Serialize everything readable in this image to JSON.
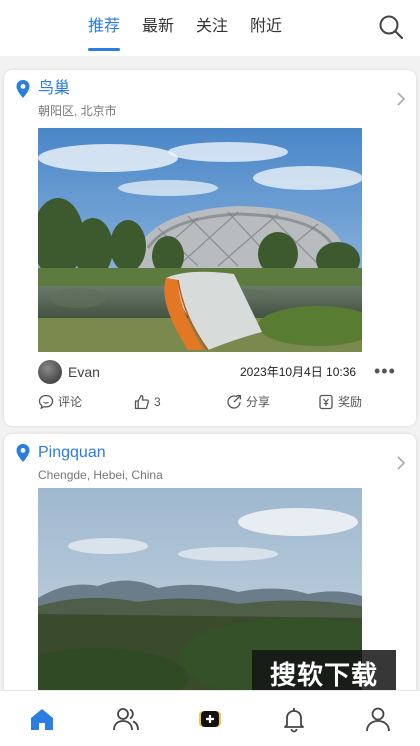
{
  "top_tabs": [
    {
      "label": "推荐"
    },
    {
      "label": "最新"
    },
    {
      "label": "关注"
    },
    {
      "label": "附近"
    }
  ],
  "posts": [
    {
      "place": "鸟巢",
      "location": "朝阳区, 北京市",
      "author": "Evan",
      "datetime": "2023年10月4日 10:36",
      "more": "•••",
      "actions": {
        "comment": "评论",
        "like": "3",
        "share": "分享",
        "reward": "奖励"
      }
    },
    {
      "place": "Pingquan",
      "location": "Chengde, Hebei, China"
    }
  ],
  "watermark": "搜软下载",
  "accent_color": "#2a7de1",
  "icons": {
    "search": "search-icon",
    "pin": "location-pin-icon",
    "chevron": "chevron-right-icon",
    "nav": [
      "home-icon",
      "friends-icon",
      "add-post-icon",
      "bell-icon",
      "profile-icon"
    ]
  }
}
